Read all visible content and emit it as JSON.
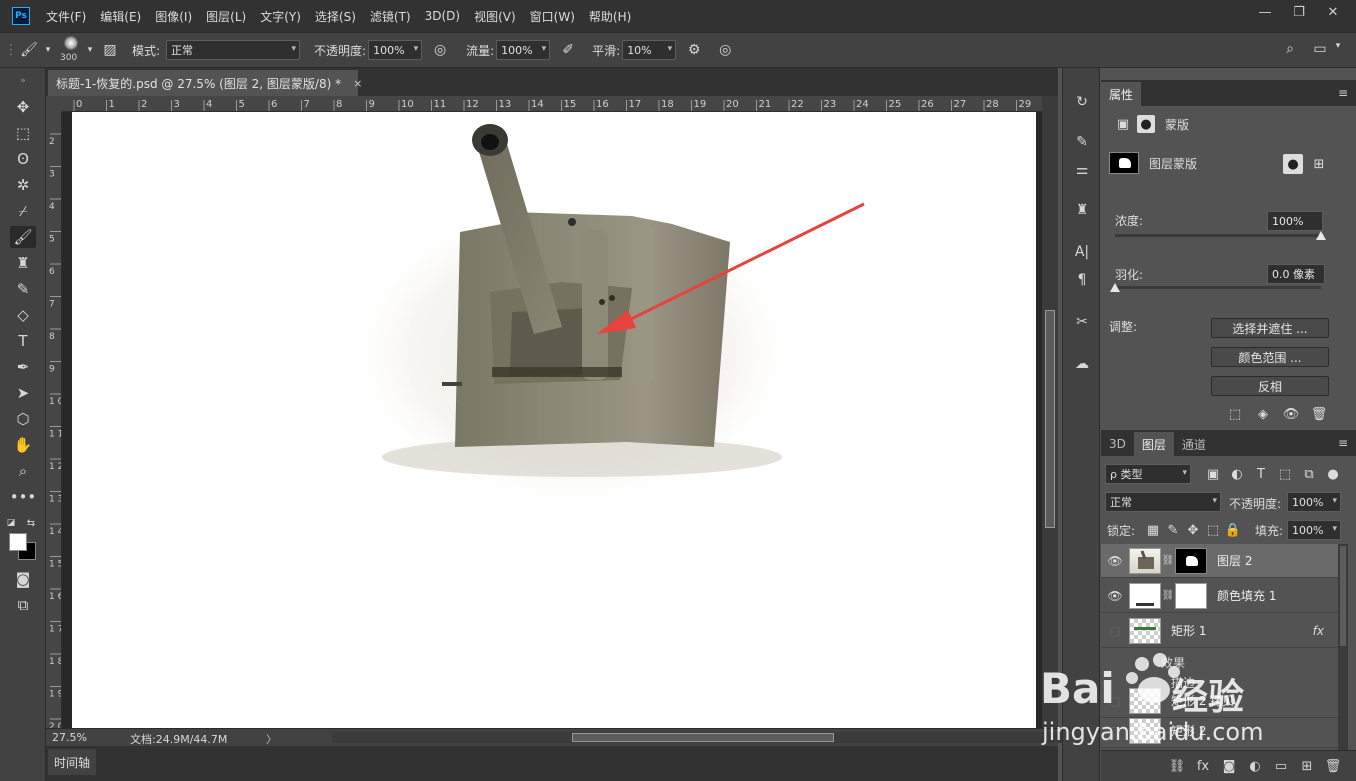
{
  "menu": {
    "app_logo": "Ps",
    "items": [
      "文件(F)",
      "编辑(E)",
      "图像(I)",
      "图层(L)",
      "文字(Y)",
      "选择(S)",
      "滤镜(T)",
      "3D(D)",
      "视图(V)",
      "窗口(W)",
      "帮助(H)"
    ]
  },
  "window_controls": {
    "minimize": "—",
    "restore": "❐",
    "close": "✕"
  },
  "options": {
    "brush_size": "300",
    "mode_label": "模式:",
    "mode_value": "正常",
    "opacity_label": "不透明度:",
    "opacity_value": "100%",
    "flow_label": "流量:",
    "flow_value": "100%",
    "smooth_label": "平滑:",
    "smooth_value": "10%"
  },
  "document": {
    "tab_title": "标题-1-恢复的.psd @ 27.5% (图层 2, 图层蒙版/8) *",
    "tab_close": "×",
    "ruler_h_ticks": [
      "0",
      "1",
      "2",
      "3",
      "4",
      "5",
      "6",
      "7",
      "8",
      "9",
      "10",
      "11",
      "12",
      "13",
      "14",
      "15",
      "16",
      "17",
      "18",
      "19",
      "20",
      "21",
      "22",
      "23",
      "24",
      "25",
      "26",
      "27",
      "28",
      "29"
    ],
    "ruler_v_ticks": [
      "2",
      "3",
      "4",
      "5",
      "6",
      "7",
      "8",
      "9",
      "1 0",
      "1 1",
      "1 2",
      "1 3",
      "1 4",
      "1 5",
      "1 6",
      "1 7",
      "1 8",
      "1 9",
      "2 0"
    ]
  },
  "status": {
    "zoom": "27.5%",
    "doc_info": "文档:24.9M/44.7M",
    "arrow": "〉"
  },
  "timeline": {
    "tab": "时间轴"
  },
  "properties": {
    "tab": "属性",
    "type_label": "蒙版",
    "layer_mask_label": "图层蒙版",
    "density_label": "浓度:",
    "density_value": "100%",
    "density_level": 1.0,
    "feather_label": "羽化:",
    "feather_value": "0.0 像素",
    "feather_level": 0.0,
    "adjust_label": "调整:",
    "buttons": [
      "选择并遮住 ...",
      "颜色范围 ...",
      "反相"
    ]
  },
  "layers": {
    "tabs": [
      "3D",
      "图层",
      "通道"
    ],
    "filter_label": "ρ 类型",
    "blend_mode": "正常",
    "opacity_label": "不透明度:",
    "opacity_value": "100%",
    "lock_label": "锁定:",
    "fill_label": "填充:",
    "fill_value": "100%",
    "items": [
      {
        "name": "图层 2",
        "visible": true,
        "selected": true
      },
      {
        "name": "颜色填充 1",
        "visible": true,
        "selected": false
      },
      {
        "name": "矩形 1",
        "visible": false,
        "selected": false,
        "fx": "fx"
      },
      {
        "name": "效果",
        "sub": true
      },
      {
        "name": "描边",
        "sub": true
      },
      {
        "name": "矩形 2 拷贝",
        "visible": false,
        "selected": false
      },
      {
        "name": "矩形 2",
        "visible": false,
        "selected": false
      }
    ]
  },
  "watermark": {
    "brand": "Bai",
    "brand_cn": "经验",
    "url": "jingyan.baidu.com"
  },
  "colors": {
    "app_bg": "#535353",
    "panel_dark": "#323232",
    "panel_mid": "#424242",
    "arrow_red": "#e8423c",
    "foreground": "#ffffff",
    "background": "#000000"
  }
}
